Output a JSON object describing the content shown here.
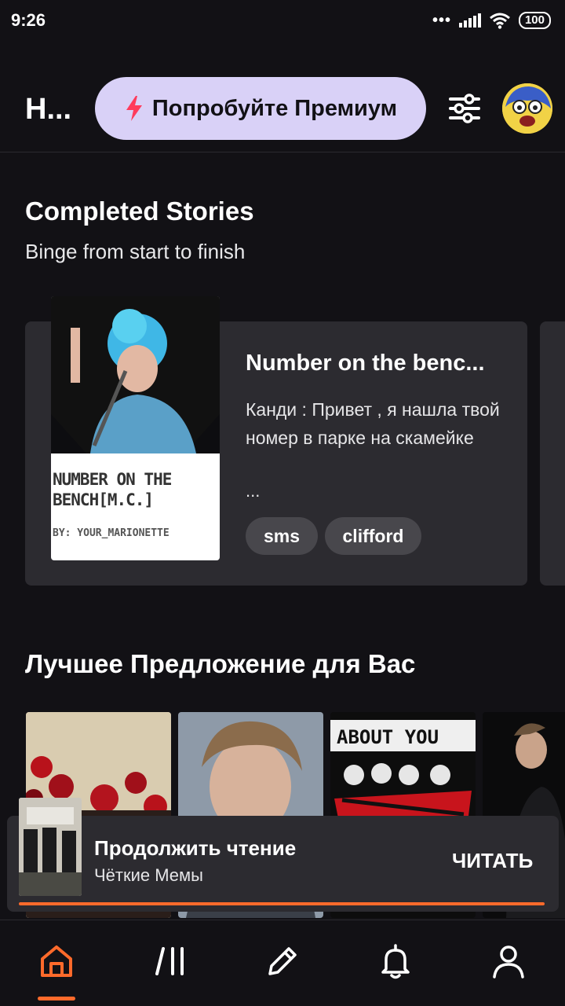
{
  "status_bar": {
    "time": "9:26",
    "battery": "100"
  },
  "header": {
    "title": "Н...",
    "premium_label": "Попробуйте Премиум"
  },
  "completed": {
    "title": "Completed Stories",
    "subtitle": "Binge from start to finish",
    "story": {
      "title": "Number on the benc...",
      "description": "Канди : Привет , я нашла твой номер в парке на скамейке",
      "ellipsis": "...",
      "cover_title": "NUMBER ON THE BENCH[M.C.]",
      "cover_author": "BY: YOUR_MARIONETTE",
      "tags": [
        "sms",
        "clifford"
      ]
    }
  },
  "recommend": {
    "title": "Лучшее Предложение для Вас"
  },
  "continue_reading": {
    "title": "Продолжить чтение",
    "story": "Чёткие Мемы",
    "button": "ЧИТАТЬ",
    "progress": 1.0
  },
  "nav": {
    "items": [
      "home-icon",
      "library-icon",
      "write-icon",
      "bell-icon",
      "profile-icon"
    ],
    "active": "home"
  },
  "colors": {
    "accent": "#ff6a2b",
    "premium_bg": "#d9d1f7",
    "bolt": "#ff3b5c",
    "card": "#2c2b30",
    "background": "#121115"
  }
}
